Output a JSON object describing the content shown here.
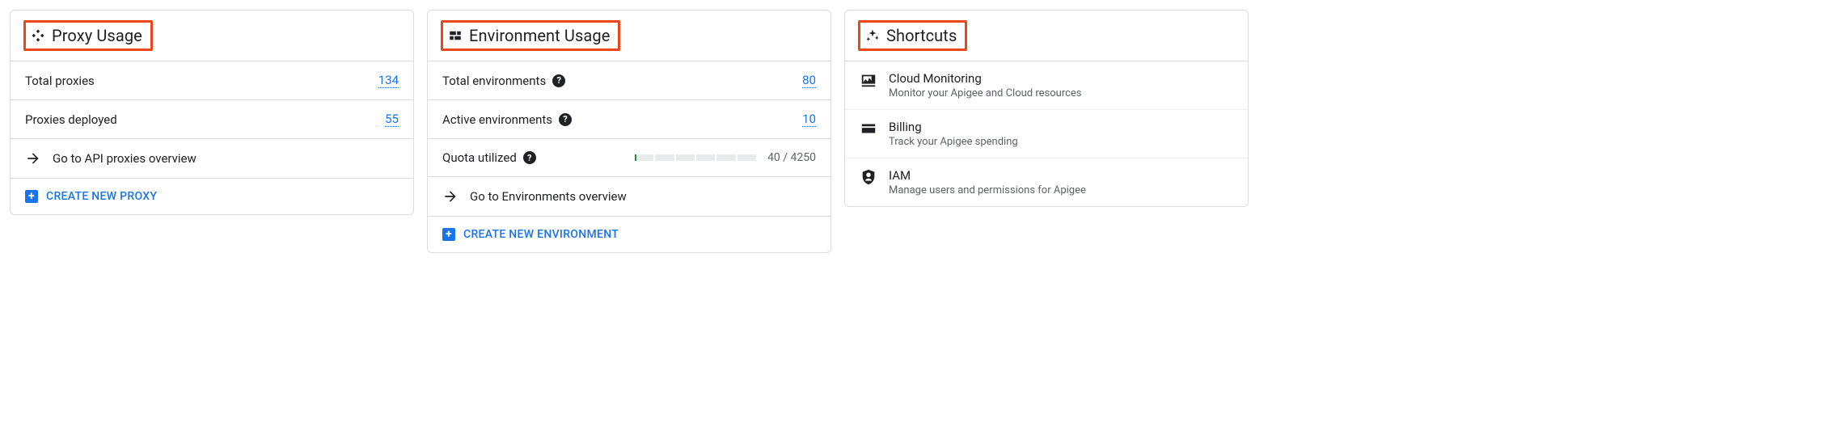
{
  "proxy_usage": {
    "title": "Proxy Usage",
    "rows": {
      "total_proxies": {
        "label": "Total proxies",
        "value": "134"
      },
      "proxies_deployed": {
        "label": "Proxies deployed",
        "value": "55"
      }
    },
    "nav": "Go to API proxies overview",
    "action": "CREATE NEW PROXY"
  },
  "environment_usage": {
    "title": "Environment Usage",
    "rows": {
      "total_envs": {
        "label": "Total environments",
        "value": "80"
      },
      "active_envs": {
        "label": "Active environments",
        "value": "10"
      },
      "quota": {
        "label": "Quota utilized",
        "used": 40,
        "total": 4250,
        "text": "40 / 4250"
      }
    },
    "nav": "Go to Environments overview",
    "action": "CREATE NEW ENVIRONMENT"
  },
  "shortcuts": {
    "title": "Shortcuts",
    "items": [
      {
        "title": "Cloud Monitoring",
        "desc": "Monitor your Apigee and Cloud resources"
      },
      {
        "title": "Billing",
        "desc": "Track your Apigee spending"
      },
      {
        "title": "IAM",
        "desc": "Manage users and permissions for Apigee"
      }
    ]
  }
}
